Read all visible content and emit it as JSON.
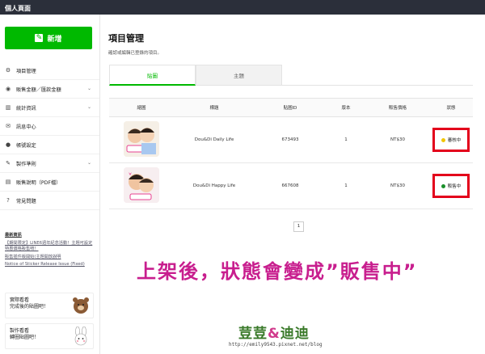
{
  "topbar": {
    "title": "個人頁面"
  },
  "sidebar": {
    "new_button": "新增",
    "items": [
      {
        "label": "項目管理",
        "icon": "gear-icon",
        "chevron": false
      },
      {
        "label": "販售金額／匯款金額",
        "icon": "coins-icon",
        "chevron": true
      },
      {
        "label": "統計資訊",
        "icon": "chart-icon",
        "chevron": true
      },
      {
        "label": "訊息中心",
        "icon": "message-icon",
        "chevron": false
      },
      {
        "label": "帳號設定",
        "icon": "user-icon",
        "chevron": false
      },
      {
        "label": "製作準則",
        "icon": "pencil-icon",
        "chevron": true
      },
      {
        "label": "販售說明（PDF檔）",
        "icon": "book-icon",
        "chevron": false
      },
      {
        "label": "常見問題",
        "icon": "question-icon",
        "chevron": false
      }
    ],
    "news": {
      "title": "最新資訊",
      "links": [
        "【期間限定】LINE6週年紀念活動！主題可設定特惠價格販售唷！",
        "販售插件版開始(主題開放說明",
        "Notice of Sticker Release Issue (Fixed)"
      ]
    },
    "promos": [
      {
        "line1": "實際看看",
        "line2": "完成後的貼圖吧！"
      },
      {
        "line1": "製作看看",
        "line2": "轉圈貼圖吧！"
      }
    ]
  },
  "main": {
    "title": "項目管理",
    "description": "確認或編輯已登錄的項目。",
    "tabs": [
      {
        "label": "貼圖",
        "active": true
      },
      {
        "label": "主題",
        "active": false
      }
    ],
    "table": {
      "headers": [
        "縮圖",
        "標題",
        "貼圖ID",
        "版本",
        "販售價格",
        "狀態"
      ],
      "rows": [
        {
          "title": "Dou&Di Daily Life",
          "id": "673493",
          "version": "1",
          "price": "NT$30",
          "status": "審核中",
          "status_color": "#f2c500"
        },
        {
          "title": "Dou&Di Happy Life",
          "id": "667608",
          "version": "1",
          "price": "NT$30",
          "status": "販售中",
          "status_color": "#1a8f2a"
        }
      ]
    },
    "pager": "1",
    "caption": "上架後，狀態會變成”販售中”",
    "watermark": {
      "part1": "荳荳",
      "amp": "&",
      "part2": "迪迪"
    },
    "url": "http://emily9543.pixnet.net/blog"
  }
}
